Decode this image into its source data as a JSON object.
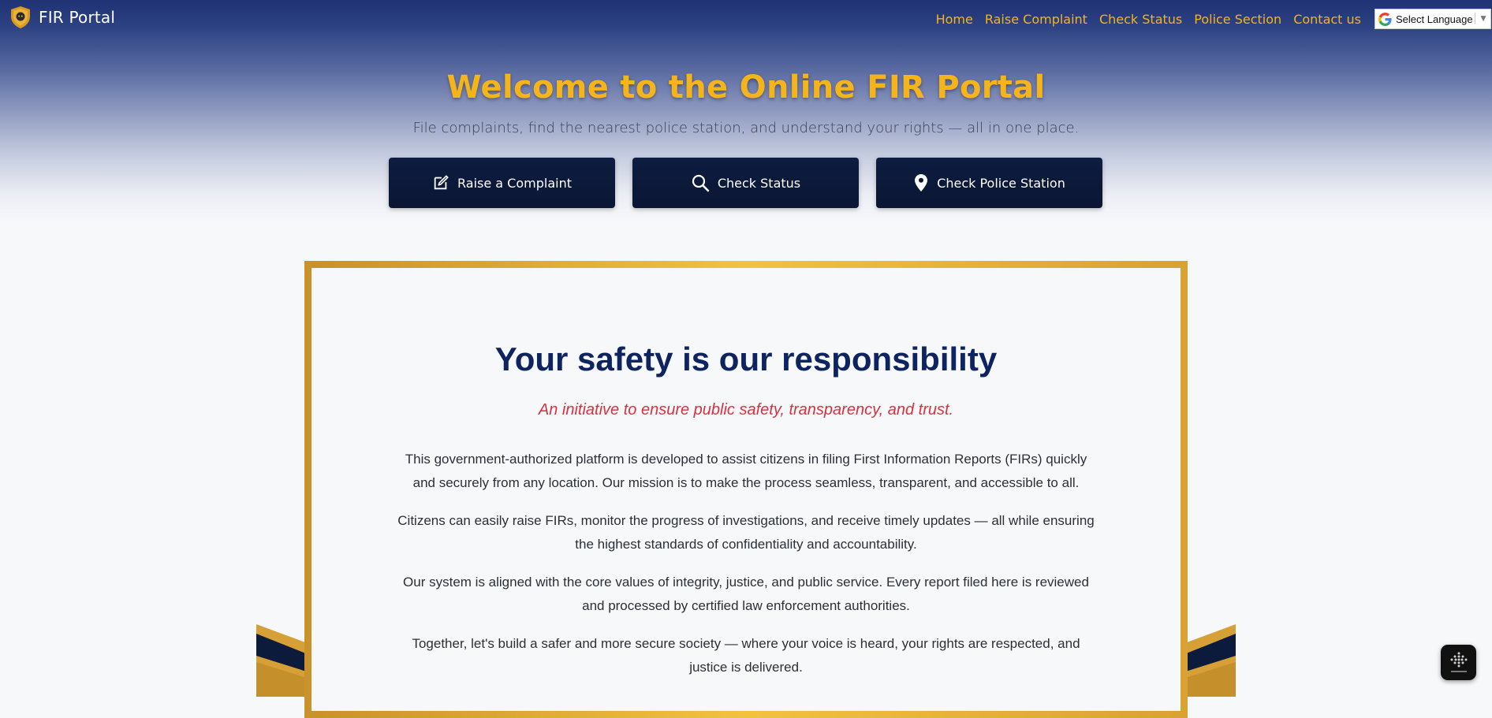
{
  "navbar": {
    "brand": "FIR Portal",
    "links": [
      "Home",
      "Raise Complaint",
      "Check Status",
      "Police Section",
      "Contact us"
    ],
    "language_select": "Select Language"
  },
  "hero": {
    "title": "Welcome to the Online FIR Portal",
    "subtitle": "File complaints, find the nearest police station, and understand your rights — all in one place.",
    "buttons": [
      {
        "label": "Raise a Complaint",
        "icon": "edit-icon"
      },
      {
        "label": "Check Status",
        "icon": "search-icon"
      },
      {
        "label": "Check Police Station",
        "icon": "map-pin-icon"
      }
    ]
  },
  "mission": {
    "title": "Your safety is our responsibility",
    "tagline": "An initiative to ensure public safety, transparency, and trust.",
    "paragraphs": [
      "This government-authorized platform is developed to assist citizens in filing First Information Reports (FIRs) quickly and securely from any location. Our mission is to make the process seamless, transparent, and accessible to all.",
      "Citizens can easily raise FIRs, monitor the progress of investigations, and receive timely updates — all while ensuring the highest standards of confidentiality and accountability.",
      "Our system is aligned with the core values of integrity, justice, and public service. Every report filed here is reviewed and processed by certified law enforcement authorities.",
      "Together, let's build a safer and more secure society — where your voice is heard, your rights are respected, and justice is delivered."
    ]
  },
  "colors": {
    "accent_gold": "#f5b419",
    "navy": "#0d2461",
    "button_navy": "#0a1633",
    "tagline_red": "#d6323f"
  },
  "widgets": {
    "assistant_icon": "blackbox-icon"
  }
}
